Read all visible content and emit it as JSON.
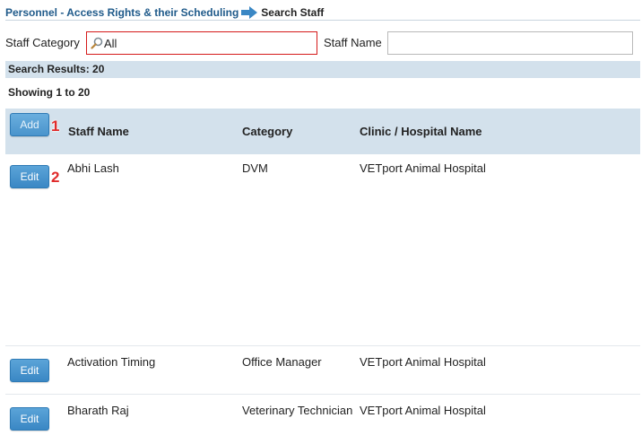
{
  "breadcrumb": {
    "parent": "Personnel - Access Rights & their Scheduling",
    "current": "Search Staff"
  },
  "filters": {
    "category_label": "Staff Category",
    "category_value": "All",
    "name_label": "Staff Name",
    "name_value": ""
  },
  "results": {
    "summary": "Search Results: 20",
    "showing": "Showing 1 to 20"
  },
  "table": {
    "add_label": "Add",
    "edit_label": "Edit",
    "columns": [
      "Staff Name",
      "Category",
      "Clinic / Hospital Name"
    ],
    "rows": [
      {
        "name": "Abhi Lash",
        "category": "DVM",
        "clinic": "VETport Animal Hospital"
      },
      {
        "name": "Activation Timing",
        "category": "Office Manager",
        "clinic": "VETport Animal Hospital"
      },
      {
        "name": "Bharath Raj",
        "category": "Veterinary Technician",
        "clinic": "VETport Animal Hospital"
      }
    ]
  },
  "annotations": [
    "1",
    "2"
  ],
  "colors": {
    "accent": "#3a87c4",
    "header_bg": "#d3e1ec",
    "link": "#1f5a8a",
    "highlight_border": "#d51a1a",
    "annotation": "#e02a2a"
  },
  "icons": {
    "breadcrumb_separator": "arrow-right-icon",
    "category_field": "search-icon"
  }
}
